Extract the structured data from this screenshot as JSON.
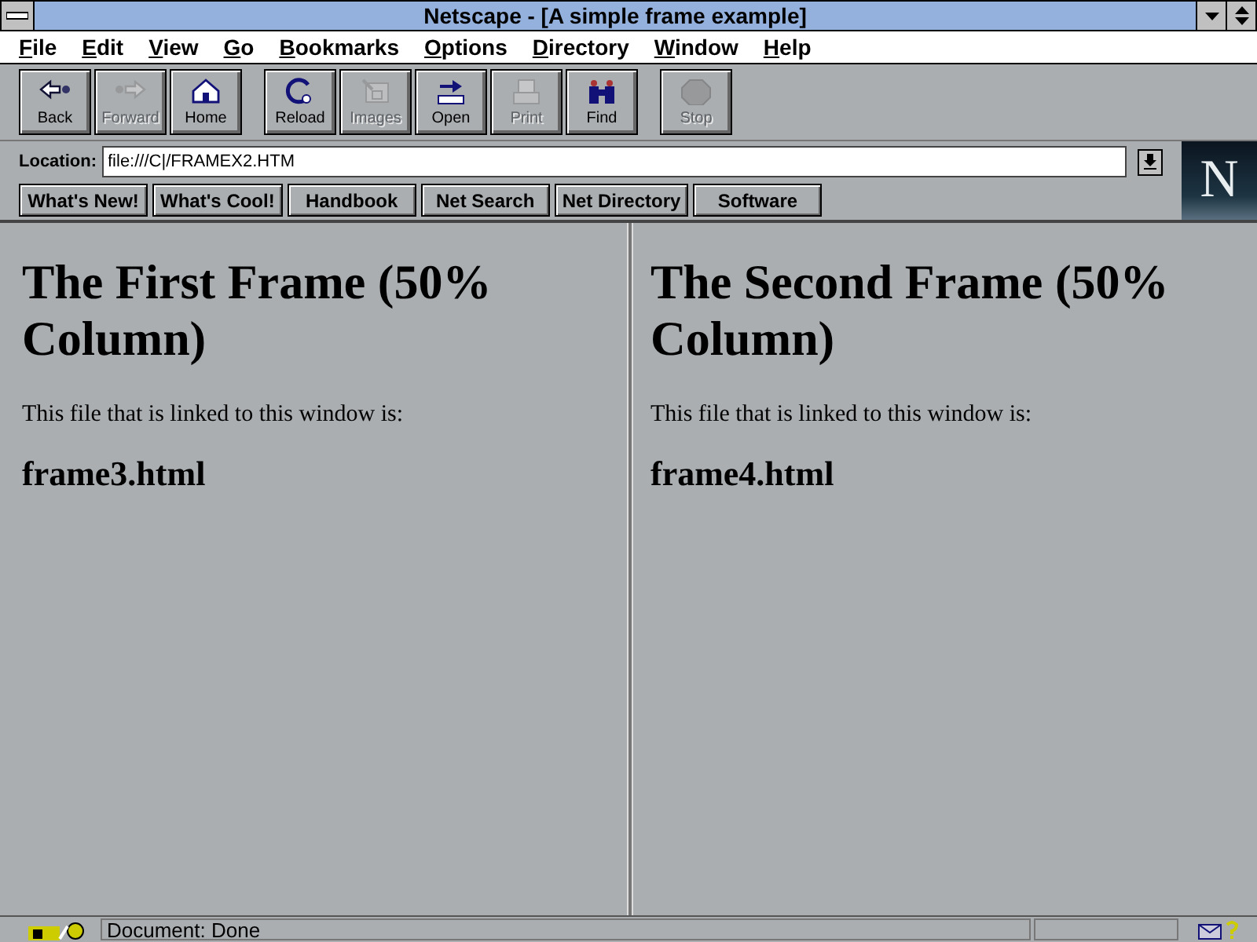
{
  "window": {
    "title": "Netscape - [A simple frame example]"
  },
  "menu": [
    "File",
    "Edit",
    "View",
    "Go",
    "Bookmarks",
    "Options",
    "Directory",
    "Window",
    "Help"
  ],
  "toolbar": [
    [
      {
        "label": "Back",
        "disabled": false
      },
      {
        "label": "Forward",
        "disabled": true
      },
      {
        "label": "Home",
        "disabled": false
      }
    ],
    [
      {
        "label": "Reload",
        "disabled": false
      },
      {
        "label": "Images",
        "disabled": true
      },
      {
        "label": "Open",
        "disabled": false
      },
      {
        "label": "Print",
        "disabled": true
      },
      {
        "label": "Find",
        "disabled": false
      }
    ],
    [
      {
        "label": "Stop",
        "disabled": true
      }
    ]
  ],
  "location": {
    "label": "Location:",
    "value": "file:///C|/FRAMEX2.HTM"
  },
  "logo": "N",
  "directory_buttons": [
    "What's New!",
    "What's Cool!",
    "Handbook",
    "Net Search",
    "Net Directory",
    "Software"
  ],
  "frames": [
    {
      "heading": "The First Frame (50% Column)",
      "text": "This file that is linked to this window is:",
      "file": "frame3.html"
    },
    {
      "heading": "The Second Frame (50% Column)",
      "text": "This file that is linked to this window is:",
      "file": "frame4.html"
    }
  ],
  "status_bar": {
    "text": "Document: Done"
  }
}
